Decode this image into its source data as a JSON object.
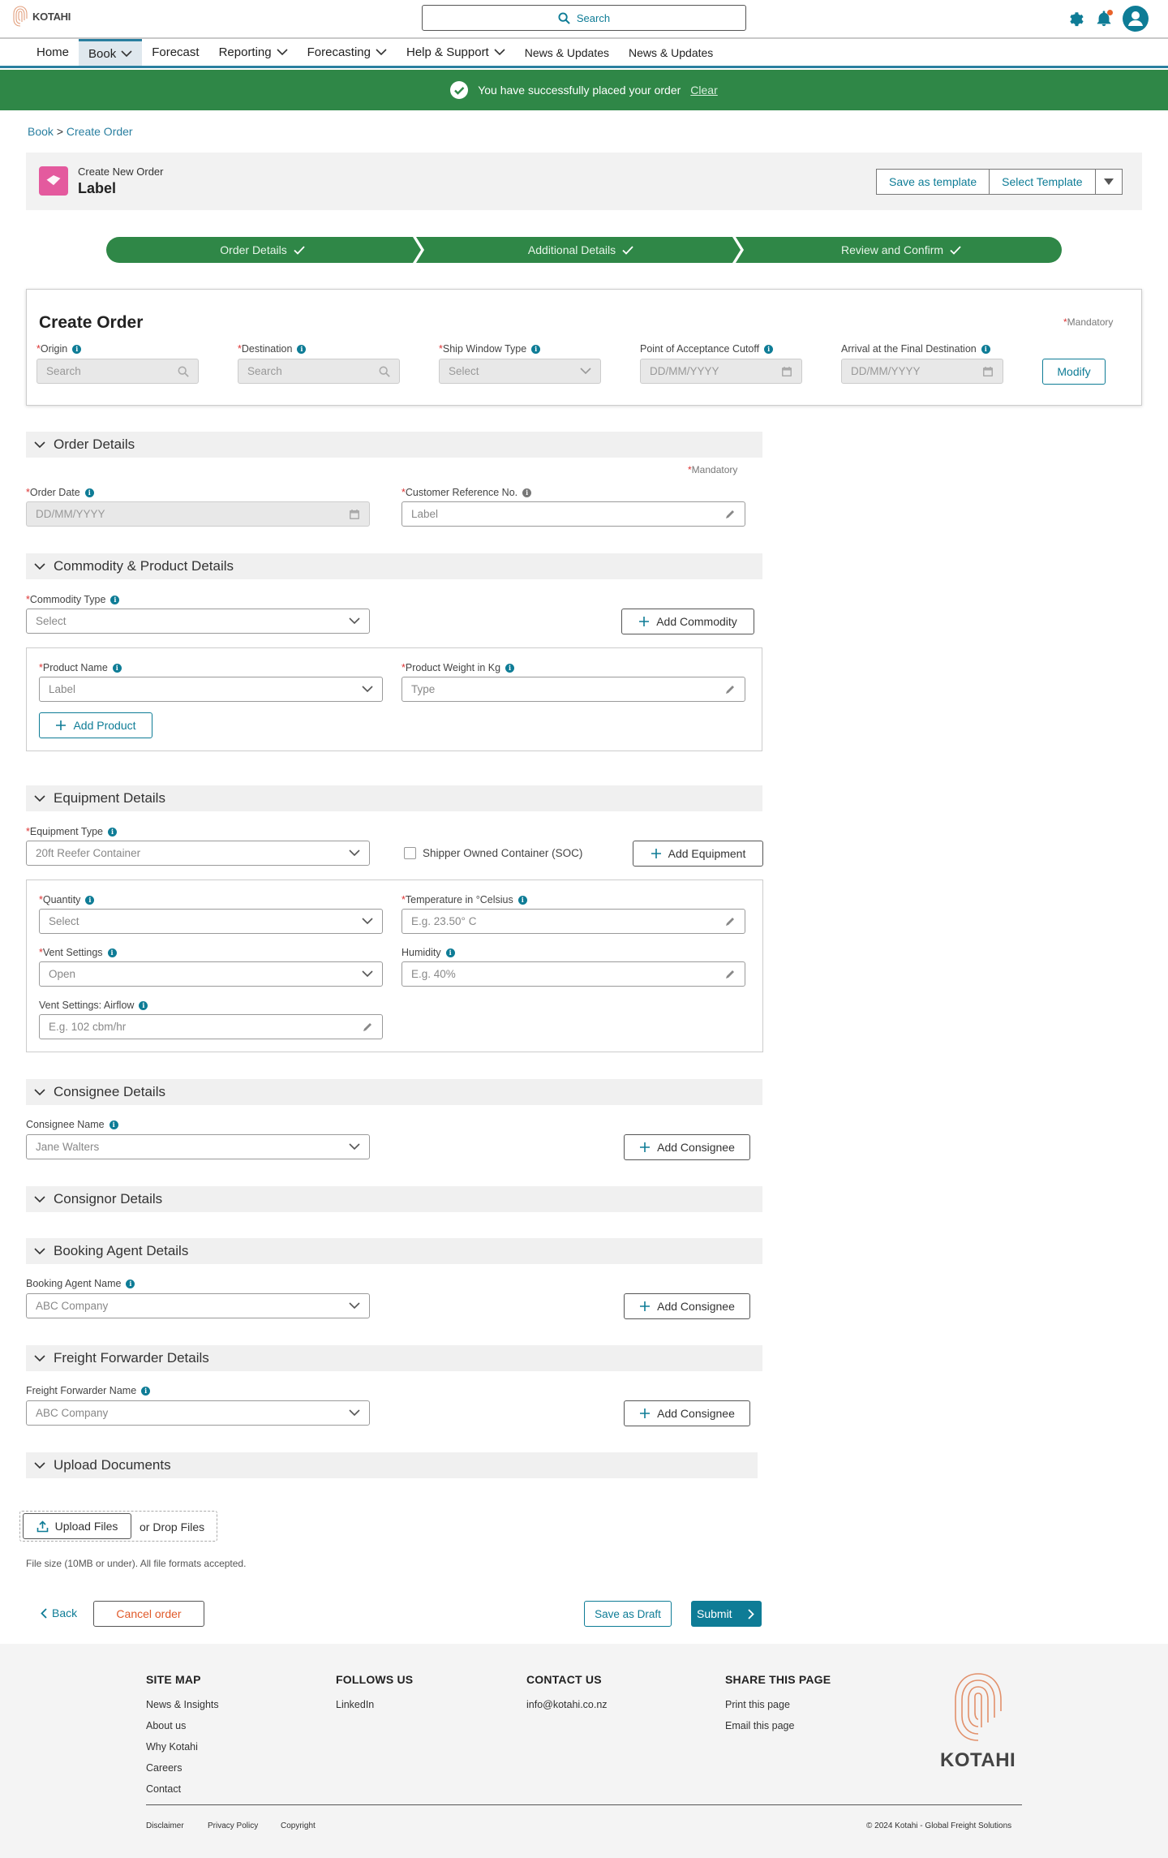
{
  "header": {
    "logo_text": "KOTAHI",
    "search_label": "Search"
  },
  "nav": {
    "items": [
      {
        "label": "Home"
      },
      {
        "label": "Book"
      },
      {
        "label": "Forecast"
      },
      {
        "label": "Reporting"
      },
      {
        "label": "Forecasting"
      },
      {
        "label": "Help & Support"
      },
      {
        "label": "News & Updates"
      },
      {
        "label": "News & Updates"
      }
    ]
  },
  "banner": {
    "message": "You have successfully placed your order",
    "clear_label": "Clear"
  },
  "breadcrumb": {
    "root": "Book",
    "separator": ">",
    "current": "Create Order"
  },
  "title_card": {
    "subtitle": "Create New Order",
    "title": "Label",
    "save_template": "Save as template",
    "select_template": "Select Template"
  },
  "stepper": {
    "steps": [
      "Order Details",
      "Additional Details",
      "Review and Confirm"
    ]
  },
  "create_order": {
    "heading": "Create Order",
    "mandatory_mark": "*",
    "mandatory_label": "Mandatory",
    "fields": [
      {
        "label": "Origin",
        "placeholder": "Search"
      },
      {
        "label": "Destination",
        "placeholder": "Search"
      },
      {
        "label": "Ship Window Type",
        "placeholder": "Select"
      },
      {
        "label": "Point of Acceptance Cutoff",
        "placeholder": "DD/MM/YYYY"
      },
      {
        "label": "Arrival at the Final Destination",
        "placeholder": "DD/MM/YYYY"
      }
    ],
    "modify_label": "Modify"
  },
  "order_details": {
    "title": "Order Details",
    "mandatory_label": "Mandatory",
    "order_date_label": "Order Date",
    "order_date_placeholder": "DD/MM/YYYY",
    "customer_ref_label": "Customer Reference No.",
    "customer_ref_value": "Label"
  },
  "commodity": {
    "title": "Commodity & Product Details",
    "type_label": "Commodity Type",
    "type_value": "Select",
    "add_commodity": "Add Commodity",
    "product_name_label": "Product Name",
    "product_name_value": "Label",
    "product_weight_label": "Product Weight in Kg",
    "product_weight_value": "Type",
    "add_product": "Add Product"
  },
  "equipment": {
    "title": "Equipment Details",
    "type_label": "Equipment Type",
    "type_value": "20ft Reefer Container",
    "soc_label": "Shipper Owned Container (SOC)",
    "add_equipment": "Add Equipment",
    "quantity_label": "Quantity",
    "quantity_value": "Select",
    "temperature_label": "Temperature in °Celsius",
    "temperature_value": "E.g. 23.50° C",
    "vent_label": "Vent Settings",
    "vent_value": "Open",
    "humidity_label": "Humidity",
    "humidity_value": "E.g. 40%",
    "airflow_label": "Vent Settings: Airflow",
    "airflow_value": "E.g. 102 cbm/hr"
  },
  "consignee": {
    "title": "Consignee Details",
    "name_label": "Consignee Name",
    "name_value": "Jane Walters",
    "add_label": "Add Consignee"
  },
  "consignor": {
    "title": "Consignor Details"
  },
  "booking_agent": {
    "title": "Booking Agent Details",
    "name_label": "Booking Agent Name",
    "name_value": "ABC Company",
    "add_label": "Add Consignee"
  },
  "freight_forwarder": {
    "title": "Freight Forwarder Details",
    "name_label": "Freight Forwarder Name",
    "name_value": "ABC Company",
    "add_label": "Add Consignee"
  },
  "upload": {
    "title": "Upload Documents",
    "button": "Upload Files",
    "drop_label": "or Drop Files",
    "note": "File size (10MB or under). All file formats accepted."
  },
  "actions": {
    "back": "Back",
    "cancel": "Cancel order",
    "save_draft": "Save as Draft",
    "submit": "Submit"
  },
  "footer": {
    "sitemap_title": "SITE MAP",
    "sitemap_links": [
      "News & Insights",
      "About us",
      "Why Kotahi",
      "Careers",
      "Contact"
    ],
    "follow_title": "FOLLOWS US",
    "follow_links": [
      "LinkedIn"
    ],
    "contact_title": "CONTACT US",
    "contact_email": "info@kotahi.co.nz",
    "share_title": "SHARE THIS PAGE",
    "share_links": [
      "Print this page",
      "Email this page"
    ],
    "logo_text": "KOTAHI",
    "legal_links": [
      "Disclaimer",
      "Privacy Policy",
      "Copyright"
    ],
    "copyright": "© 2024 Kotahi - Global Freight Solutions"
  },
  "colors": {
    "primary": "#0e7c96",
    "success": "#2f8747",
    "brand_accent": "#e45a9e",
    "required": "#d33333"
  }
}
